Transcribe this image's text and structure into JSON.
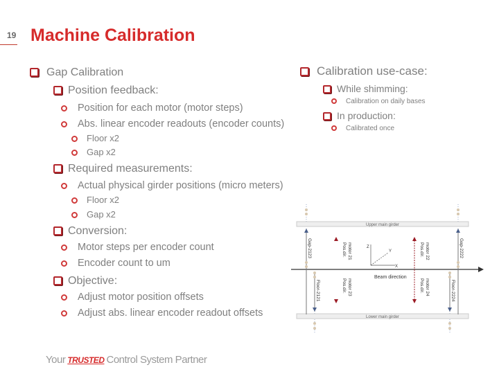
{
  "page_number": "19",
  "title": "Machine Calibration",
  "left": {
    "gap_calibration": "Gap Calibration",
    "position_feedback": "Position feedback:",
    "pf_items": [
      "Position for each motor (motor steps)",
      "Abs. linear encoder readouts (encoder counts)"
    ],
    "pf_sub": [
      "Floor x2",
      "Gap x2"
    ],
    "required": "Required measurements:",
    "req_items": [
      "Actual physical girder positions (micro meters)"
    ],
    "req_sub": [
      "Floor x2",
      "Gap x2"
    ],
    "conversion": "Conversion:",
    "conv_items": [
      "Motor steps per encoder count",
      "Encoder count to um"
    ],
    "objective": "Objective:",
    "obj_items": [
      "Adjust motor position offsets",
      "Adjust abs. linear encoder readout offsets"
    ]
  },
  "right": {
    "usecase": "Calibration use-case:",
    "shimming": "While shimming:",
    "shimming_sub": "Calibration on daily bases",
    "production": "In production:",
    "production_sub": "Calibrated once"
  },
  "diagram": {
    "upper_girder": "Upper main girder",
    "lower_girder": "Lower main girder",
    "beam": "Beam direction",
    "gap_left": "Gap-2123",
    "gap_right": "Gap-2222",
    "floor_left": "Floor-2121",
    "floor_right": "Floor-2224",
    "motor21": "motor 21",
    "motor22": "motor 22",
    "motor23": "motor 23",
    "motor24": "motor 24",
    "pos_dir": "Pos.dir.",
    "axis_x": "X",
    "axis_y": "Y",
    "axis_z": "Z",
    "colors": {
      "motor": "#9b1b25",
      "encoder": "#4a5f8a",
      "node": "#d8c8b0"
    }
  },
  "footer": {
    "pre": "Your",
    "brand": "TRUSTED",
    "post": "Control System Partner"
  }
}
